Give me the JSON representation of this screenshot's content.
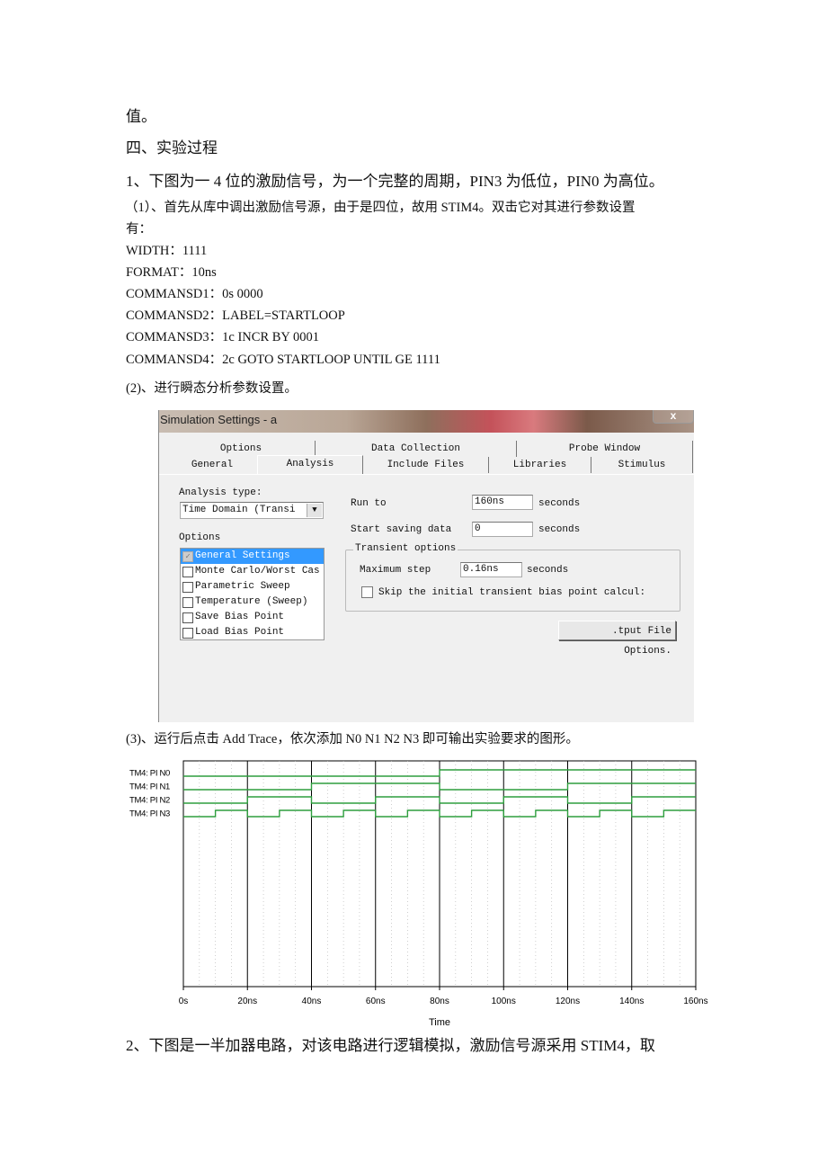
{
  "doc": {
    "line_prev_end": "值。",
    "section_heading": "四、实验过程",
    "item1": "1、下图为一 4 位的激励信号，为一个完整的周期，PIN3 为低位，PIN0 为高位。",
    "step1_line1": "（1）、首先从库中调出激励信号源，由于是四位，故用 STIM4。双击它对其进行参数设置",
    "step1_line2": "有：",
    "params": [
      "WIDTH：1111",
      "FORMAT：10ns",
      "COMMANSD1：0s 0000",
      "COMMANSD2：LABEL=STARTLOOP",
      "COMMANSD3：1c INCR BY 0001",
      "COMMANSD4：2c GOTO STARTLOOP UNTIL GE 1111"
    ],
    "step2": "(2)、进行瞬态分析参数设置。",
    "step3": "(3)、运行后点击 Add Trace，依次添加 N0 N1 N2 N3 即可输出实验要求的图形。",
    "item2": "2、下图是一半加器电路，对该电路进行逻辑模拟，激励信号源采用 STIM4，取"
  },
  "dialog": {
    "title": "Simulation Settings - a",
    "close": "x",
    "tabs_back": [
      "Options",
      "Data Collection",
      "Probe Window"
    ],
    "tabs_front": [
      "General",
      "Analysis",
      "Include Files",
      "Libraries",
      "Stimulus"
    ],
    "selected_tab": "Analysis",
    "analysis_type_label": "Analysis type:",
    "analysis_type_value": "Time Domain (Transi",
    "options_label": "Options",
    "options": [
      {
        "label": "General Settings",
        "checked": true,
        "selected": true
      },
      {
        "label": "Monte Carlo/Worst Cas",
        "checked": false
      },
      {
        "label": "Parametric Sweep",
        "checked": false
      },
      {
        "label": "Temperature (Sweep)",
        "checked": false
      },
      {
        "label": "Save Bias Point",
        "checked": false
      },
      {
        "label": "Load Bias Point",
        "checked": false
      }
    ],
    "run_to_label": "Run to",
    "run_to_value": "160ns",
    "start_saving_label": "Start saving data",
    "start_saving_value": "0",
    "seconds": "seconds",
    "transient_group": "Transient options",
    "max_step_label": "Maximum step",
    "max_step_value": "0.16ns",
    "skip_bias_label": "Skip the initial transient bias point calcul:",
    "skip_bias_checked": false,
    "output_file_button": ".tput File Options."
  },
  "chart_data": {
    "type": "line",
    "subtype": "digital-waveform",
    "xlabel": "Time",
    "xlim": [
      0,
      160
    ],
    "x_unit": "ns",
    "x_ticks": [
      "0s",
      "20ns",
      "40ns",
      "60ns",
      "80ns",
      "100ns",
      "120ns",
      "140ns",
      "160ns"
    ],
    "grid": true,
    "line_color": "#2e9e3e",
    "x": [
      0,
      10,
      20,
      30,
      40,
      50,
      60,
      70,
      80,
      90,
      100,
      110,
      120,
      130,
      140,
      150
    ],
    "series": [
      {
        "name": "TM4: PI N0",
        "values": [
          0,
          0,
          0,
          0,
          0,
          0,
          0,
          0,
          1,
          1,
          1,
          1,
          1,
          1,
          1,
          1
        ]
      },
      {
        "name": "TM4: PI N1",
        "values": [
          0,
          0,
          0,
          0,
          1,
          1,
          1,
          1,
          0,
          0,
          0,
          0,
          1,
          1,
          1,
          1
        ]
      },
      {
        "name": "TM4: PI N2",
        "values": [
          0,
          0,
          1,
          1,
          0,
          0,
          1,
          1,
          0,
          0,
          1,
          1,
          0,
          0,
          1,
          1
        ]
      },
      {
        "name": "TM4: PI N3",
        "values": [
          0,
          1,
          0,
          1,
          0,
          1,
          0,
          1,
          0,
          1,
          0,
          1,
          0,
          1,
          0,
          1
        ]
      }
    ]
  }
}
